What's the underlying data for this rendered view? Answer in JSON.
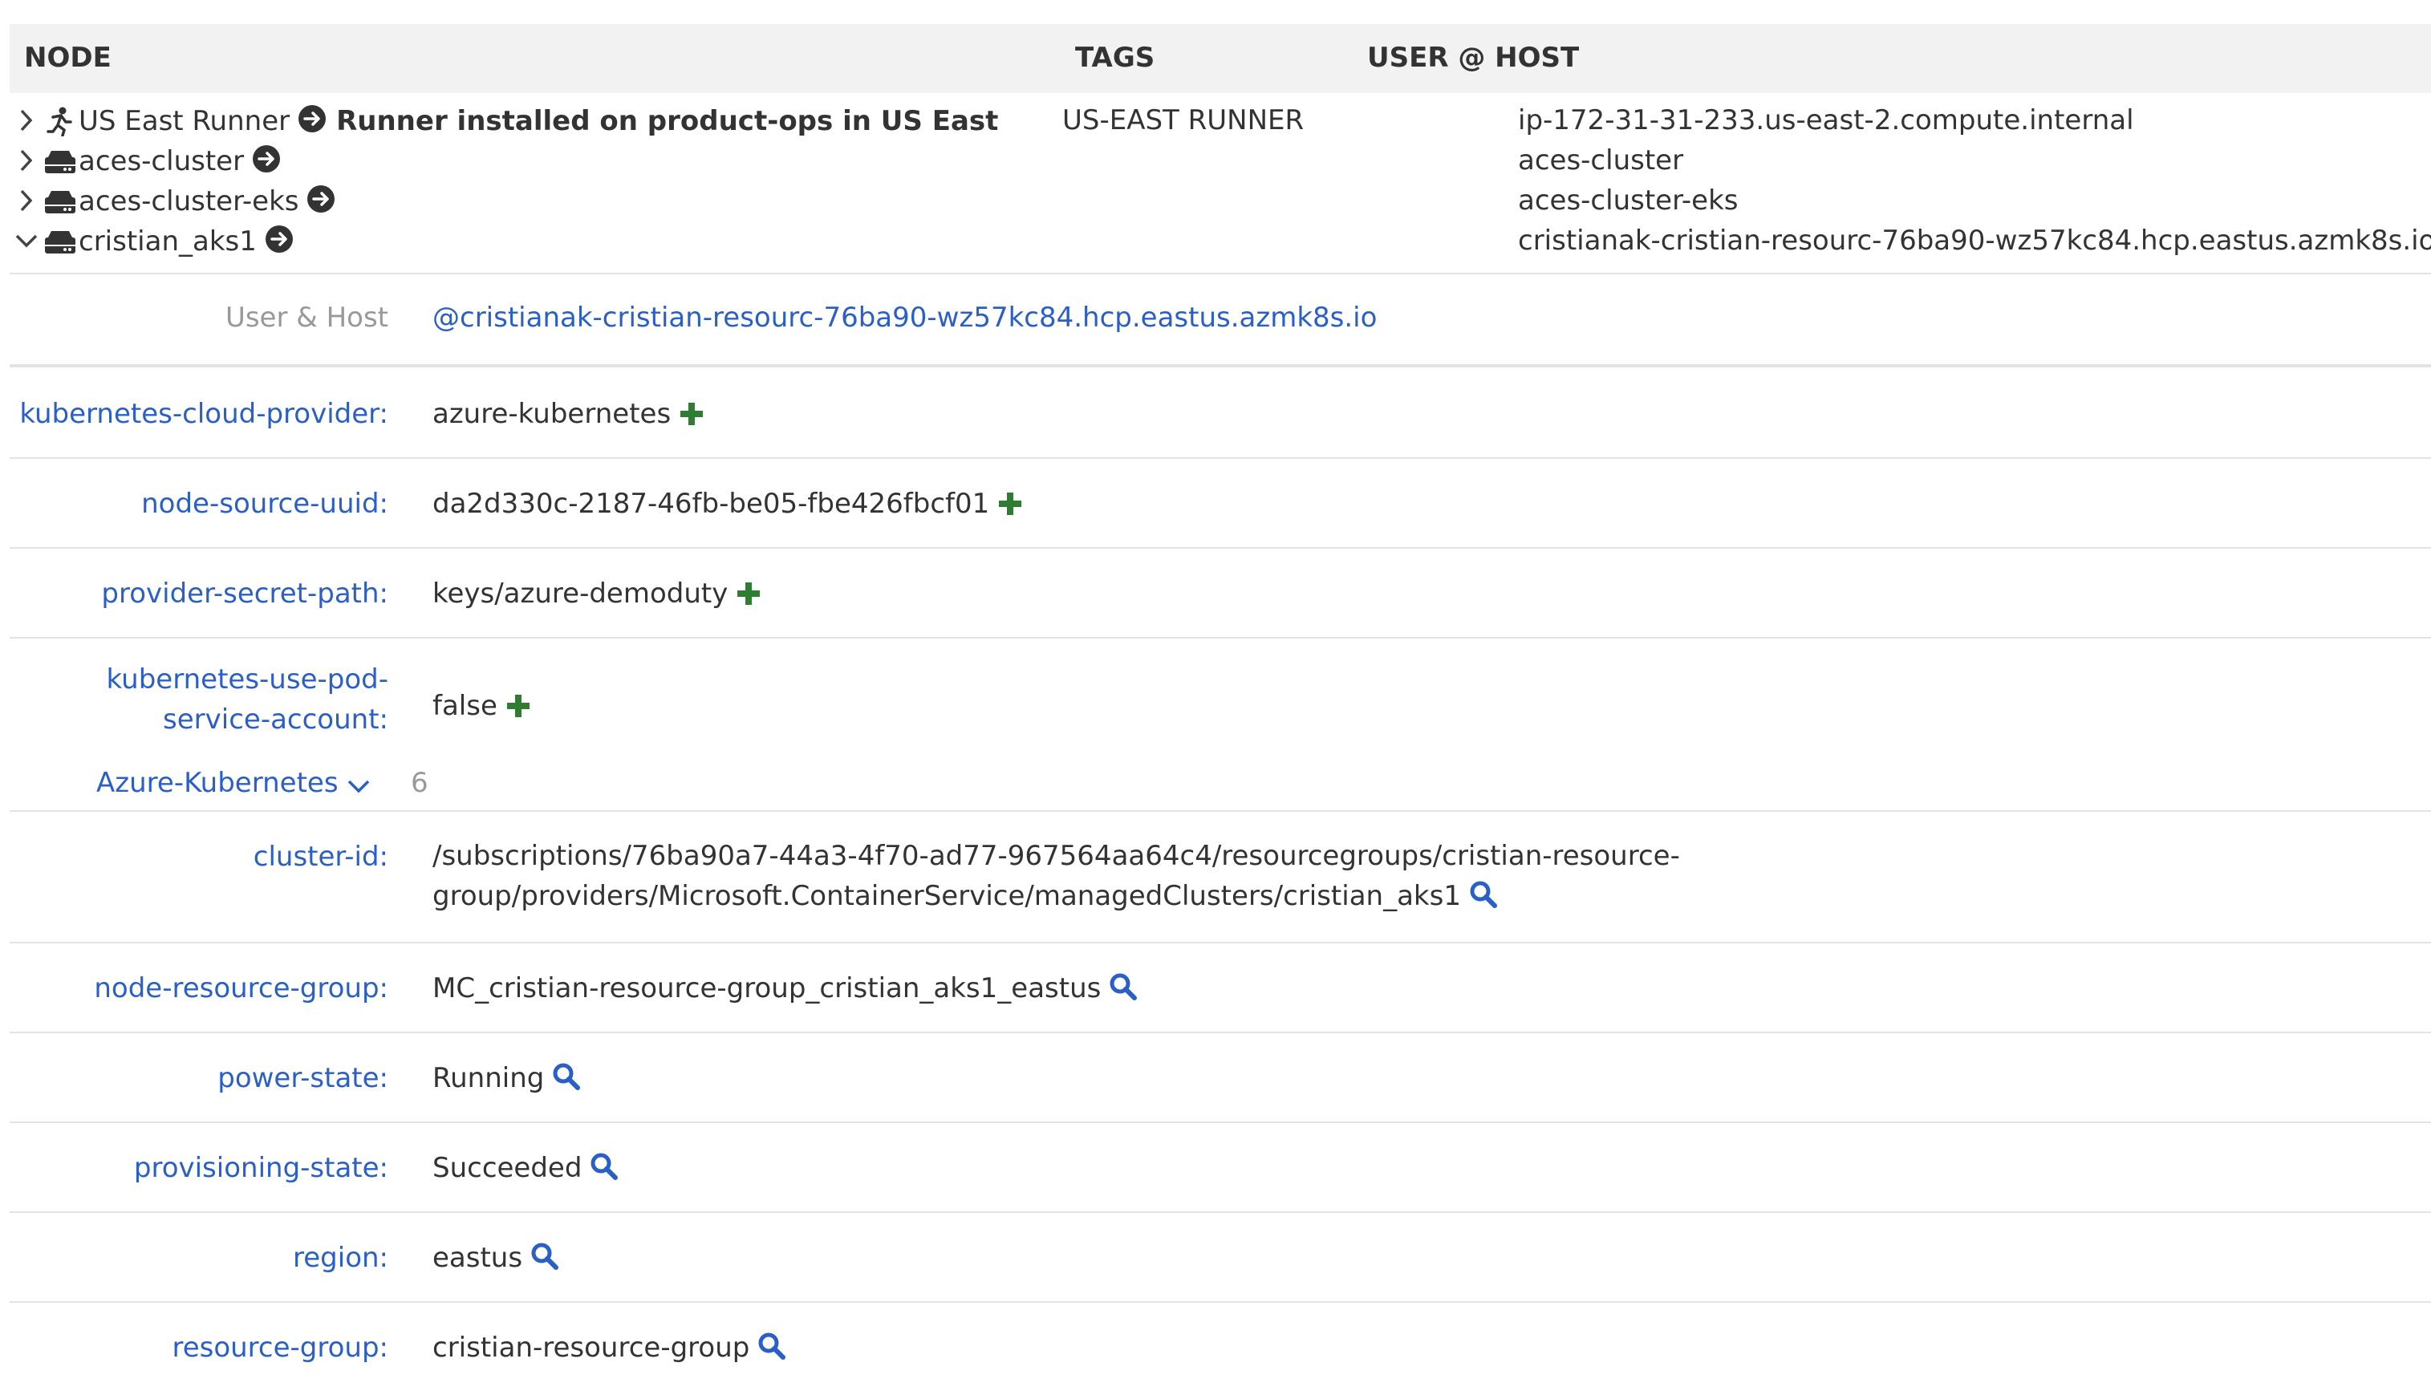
{
  "header": {
    "node": "NODE",
    "tags": "TAGS",
    "user_host": "USER @ HOST"
  },
  "nodes": [
    {
      "name": "US East Runner",
      "description": "Runner installed on product-ops in US East",
      "tags": "US-EAST RUNNER",
      "host": "ip-172-31-31-233.us-east-2.compute.internal",
      "icon": "runner-icon",
      "expanded": false
    },
    {
      "name": "aces-cluster",
      "description": "",
      "tags": "",
      "host": "aces-cluster",
      "icon": "server-icon",
      "expanded": false
    },
    {
      "name": "aces-cluster-eks",
      "description": "",
      "tags": "",
      "host": "aces-cluster-eks",
      "icon": "server-icon",
      "expanded": false
    },
    {
      "name": "cristian_aks1",
      "description": "",
      "tags": "",
      "host": "cristianak-cristian-resourc-76ba90-wz57kc84.hcp.eastus.azmk8s.io",
      "icon": "server-icon",
      "expanded": true
    }
  ],
  "detail": {
    "user_host_label": "User & Host",
    "user_host_value": "@cristianak-cristian-resourc-76ba90-wz57kc84.hcp.eastus.azmk8s.io",
    "attributes": [
      {
        "key": "kubernetes-cloud-provider:",
        "value": "azure-kubernetes"
      },
      {
        "key": "node-source-uuid:",
        "value": "da2d330c-2187-46fb-be05-fbe426fbcf01"
      },
      {
        "key": "provider-secret-path:",
        "value": "keys/azure-demoduty"
      },
      {
        "key_line1": "kubernetes-use-pod-",
        "key_line2": "service-account:",
        "value": "false"
      }
    ],
    "group": {
      "label": "Azure-Kubernetes",
      "count": "6"
    },
    "group_attributes": [
      {
        "key": "cluster-id:",
        "value_line1": "/subscriptions/76ba90a7-44a3-4f70-ad77-967564aa64c4/resourcegroups/cristian-resource-",
        "value_line2": "group/providers/Microsoft.ContainerService/managedClusters/cristian_aks1"
      },
      {
        "key": "node-resource-group:",
        "value": "MC_cristian-resource-group_cristian_aks1_eastus"
      },
      {
        "key": "power-state:",
        "value": "Running"
      },
      {
        "key": "provisioning-state:",
        "value": "Succeeded"
      },
      {
        "key": "region:",
        "value": "eastus"
      },
      {
        "key": "resource-group:",
        "value": "cristian-resource-group"
      }
    ]
  },
  "colors": {
    "link": "#2b5fc8",
    "plus": "#2e7d32",
    "header_bg": "#f2f2f2"
  }
}
